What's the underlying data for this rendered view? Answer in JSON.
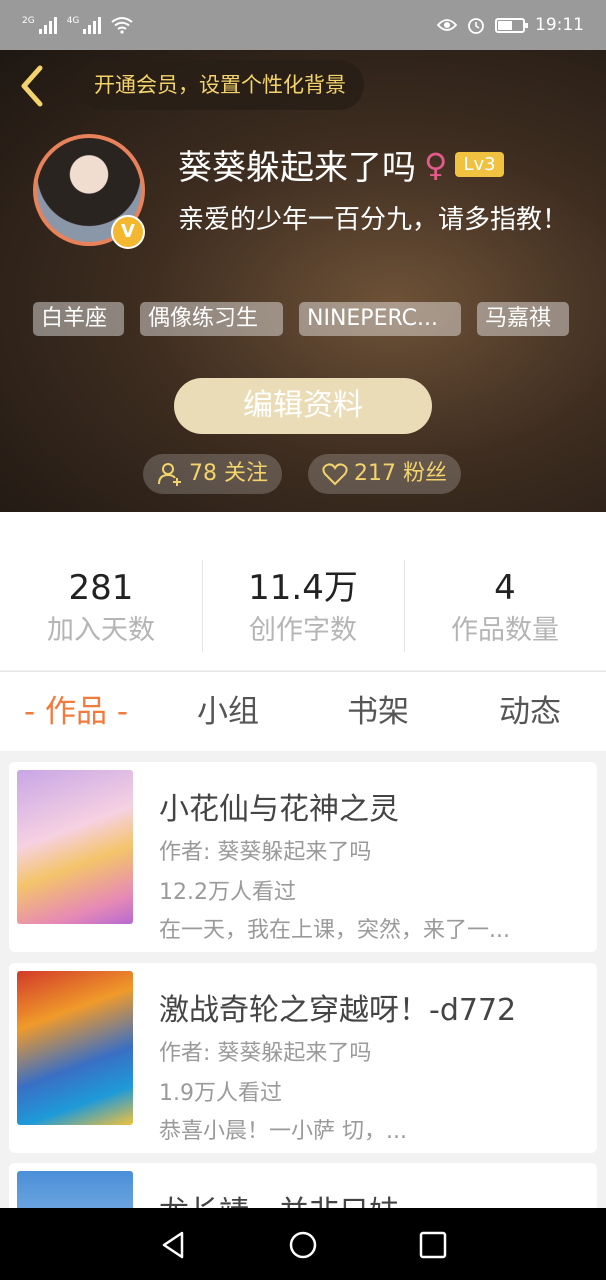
{
  "status_bar": {
    "net1": "2G",
    "net2": "4G",
    "time": "19:11",
    "battery_level": 0.6
  },
  "header": {
    "vip_prompt": "开通会员，设置个性化背景",
    "nickname": "葵葵躲起来了吗",
    "gender_symbol": "♀",
    "level": "Lv3",
    "verified_mark": "V",
    "signature": "亲爱的少年一百分九，请多指教！",
    "tags": [
      "白羊座",
      "偶像练习生",
      "NINEPERC...",
      "马嘉祺"
    ],
    "edit_button": "编辑资料",
    "following": "78 关注",
    "fans": "217 粉丝"
  },
  "stats": [
    {
      "value": "281",
      "label": "加入天数"
    },
    {
      "value": "11.4万",
      "label": "创作字数"
    },
    {
      "value": "4",
      "label": "作品数量"
    }
  ],
  "tabs": [
    {
      "label": "- 作品 -",
      "active": true
    },
    {
      "label": "小组",
      "active": false
    },
    {
      "label": "书架",
      "active": false
    },
    {
      "label": "动态",
      "active": false
    }
  ],
  "works": [
    {
      "title": "小花仙与花神之灵",
      "author": "作者: 葵葵躲起来了吗",
      "views": "12.2万人看过",
      "desc": "在一天，我在上课，突然，来了一..."
    },
    {
      "title": "激战奇轮之穿越呀！-d772",
      "author": "作者: 葵葵躲起来了吗",
      "views": "1.9万人看过",
      "desc": "恭喜小晨！一小萨 切，..."
    },
    {
      "title": "龙长靖，并非只妹"
    }
  ],
  "colors": {
    "accent": "#f27a3c",
    "gold": "#f3d36b",
    "edit_button_bg": "#e9dcb6"
  }
}
